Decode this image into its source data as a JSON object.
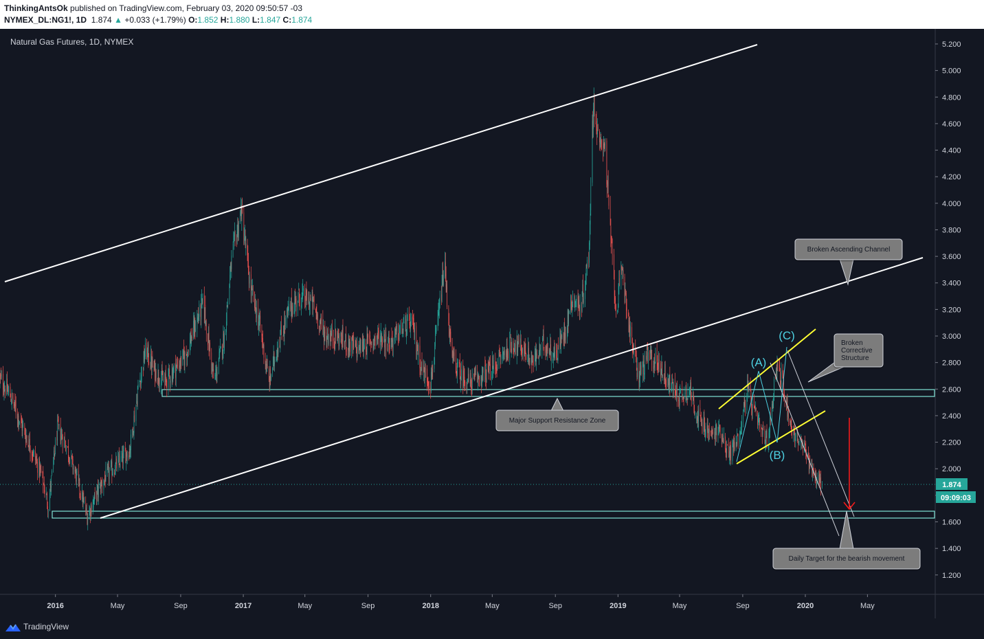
{
  "header": {
    "author": "ThinkingAntsOk",
    "published_text": "published on TradingView.com, February 03, 2020 09:50:57 -03",
    "symbol": "NYMEX_DL:NG1!, 1D",
    "last": "1.874",
    "change": "+0.033 (+1.79%)",
    "open_label": "O:",
    "open": "1.852",
    "high_label": "H:",
    "high": "1.880",
    "low_label": "L:",
    "low": "1.847",
    "close_label": "C:",
    "close": "1.874"
  },
  "chart": {
    "title": "Natural Gas Futures, 1D, NYMEX",
    "price_tag": "1.874",
    "countdown": "09:09:03"
  },
  "annotations": {
    "broken_channel": "Broken Ascending Channel",
    "broken_structure": [
      "Broken",
      "Corrective",
      "Structure"
    ],
    "support_zone": "Major Support Resistance Zone",
    "daily_target": "Daily Target for the bearish movement",
    "wave_a": "(A)",
    "wave_b": "(B)",
    "wave_c": "(C)"
  },
  "footer": {
    "brand": "TradingView"
  },
  "colors": {
    "background": "#131722",
    "up": "#26a69a",
    "down": "#ef5350",
    "channel": "#ffffff",
    "zone": "#7fe3d6",
    "wave_line": "#ffff33",
    "wave_label": "#4dd0e1",
    "target_arrow": "#ff0000"
  },
  "chart_data": {
    "type": "candlestick",
    "title": "Natural Gas Futures, 1D, NYMEX",
    "ylim": [
      1.1,
      5.3
    ],
    "y_ticks": [
      "1.200",
      "1.400",
      "1.600",
      "1.800",
      "2.000",
      "2.200",
      "2.400",
      "2.600",
      "2.800",
      "3.000",
      "3.200",
      "3.400",
      "3.600",
      "3.800",
      "4.000",
      "4.200",
      "4.400",
      "4.600",
      "4.800",
      "5.000",
      "5.200"
    ],
    "x_ticks": [
      "2016",
      "May",
      "Sep",
      "2017",
      "May",
      "Sep",
      "2018",
      "May",
      "Sep",
      "2019",
      "May",
      "Sep",
      "2020",
      "May"
    ],
    "x_tick_dates": [
      "2016-01-01",
      "2016-05-01",
      "2016-09-01",
      "2017-01-01",
      "2017-05-01",
      "2017-09-01",
      "2018-01-01",
      "2018-05-01",
      "2018-09-01",
      "2019-01-01",
      "2019-05-01",
      "2019-09-01",
      "2020-01-01",
      "2020-05-01"
    ],
    "x_range": [
      "2015-09-15",
      "2020-09-10"
    ],
    "price_path": [
      [
        "2015-09-15",
        2.68
      ],
      [
        "2015-10-05",
        2.55
      ],
      [
        "2015-10-25",
        2.35
      ],
      [
        "2015-11-15",
        2.15
      ],
      [
        "2015-12-05",
        1.95
      ],
      [
        "2015-12-18",
        1.72
      ],
      [
        "2016-01-05",
        2.3
      ],
      [
        "2016-01-20",
        2.2
      ],
      [
        "2016-02-10",
        1.95
      ],
      [
        "2016-03-03",
        1.64
      ],
      [
        "2016-03-20",
        1.8
      ],
      [
        "2016-04-10",
        1.95
      ],
      [
        "2016-05-05",
        2.05
      ],
      [
        "2016-05-25",
        2.15
      ],
      [
        "2016-06-10",
        2.6
      ],
      [
        "2016-06-25",
        2.9
      ],
      [
        "2016-07-10",
        2.75
      ],
      [
        "2016-08-01",
        2.65
      ],
      [
        "2016-08-20",
        2.75
      ],
      [
        "2016-09-10",
        2.85
      ],
      [
        "2016-10-01",
        3.1
      ],
      [
        "2016-10-15",
        3.25
      ],
      [
        "2016-11-05",
        2.65
      ],
      [
        "2016-11-25",
        3.0
      ],
      [
        "2016-12-10",
        3.6
      ],
      [
        "2016-12-28",
        3.95
      ],
      [
        "2017-01-15",
        3.35
      ],
      [
        "2017-02-01",
        3.1
      ],
      [
        "2017-02-20",
        2.65
      ],
      [
        "2017-03-10",
        2.95
      ],
      [
        "2017-04-01",
        3.2
      ],
      [
        "2017-04-20",
        3.3
      ],
      [
        "2017-05-15",
        3.25
      ],
      [
        "2017-06-10",
        3.0
      ],
      [
        "2017-07-01",
        3.0
      ],
      [
        "2017-07-20",
        2.95
      ],
      [
        "2017-08-10",
        2.9
      ],
      [
        "2017-09-01",
        2.95
      ],
      [
        "2017-09-25",
        3.0
      ],
      [
        "2017-10-15",
        2.95
      ],
      [
        "2017-11-05",
        3.05
      ],
      [
        "2017-11-25",
        3.1
      ],
      [
        "2017-12-15",
        2.75
      ],
      [
        "2018-01-01",
        2.65
      ],
      [
        "2018-01-15",
        3.1
      ],
      [
        "2018-01-28",
        3.55
      ],
      [
        "2018-02-10",
        2.85
      ],
      [
        "2018-03-01",
        2.7
      ],
      [
        "2018-03-20",
        2.65
      ],
      [
        "2018-04-10",
        2.7
      ],
      [
        "2018-05-01",
        2.75
      ],
      [
        "2018-05-20",
        2.85
      ],
      [
        "2018-06-10",
        2.95
      ],
      [
        "2018-07-01",
        2.9
      ],
      [
        "2018-07-20",
        2.8
      ],
      [
        "2018-08-10",
        2.95
      ],
      [
        "2018-09-01",
        2.85
      ],
      [
        "2018-09-20",
        3.05
      ],
      [
        "2018-10-05",
        3.3
      ],
      [
        "2018-10-20",
        3.2
      ],
      [
        "2018-11-05",
        3.6
      ],
      [
        "2018-11-14",
        4.8
      ],
      [
        "2018-11-25",
        4.4
      ],
      [
        "2018-12-05",
        4.5
      ],
      [
        "2018-12-15",
        3.9
      ],
      [
        "2018-12-28",
        3.2
      ],
      [
        "2019-01-10",
        3.5
      ],
      [
        "2019-01-25",
        3.0
      ],
      [
        "2019-02-10",
        2.7
      ],
      [
        "2019-03-01",
        2.85
      ],
      [
        "2019-03-20",
        2.8
      ],
      [
        "2019-04-10",
        2.65
      ],
      [
        "2019-05-01",
        2.55
      ],
      [
        "2019-05-20",
        2.6
      ],
      [
        "2019-06-10",
        2.35
      ],
      [
        "2019-07-01",
        2.25
      ],
      [
        "2019-07-20",
        2.3
      ],
      [
        "2019-08-05",
        2.1
      ],
      [
        "2019-08-25",
        2.25
      ],
      [
        "2019-09-10",
        2.6
      ],
      [
        "2019-09-25",
        2.4
      ],
      [
        "2019-10-10",
        2.25
      ],
      [
        "2019-10-20",
        2.2
      ],
      [
        "2019-11-06",
        2.8
      ],
      [
        "2019-11-20",
        2.6
      ],
      [
        "2019-12-05",
        2.3
      ],
      [
        "2019-12-20",
        2.2
      ],
      [
        "2020-01-05",
        2.1
      ],
      [
        "2020-01-20",
        1.95
      ],
      [
        "2020-02-03",
        1.874
      ]
    ],
    "last_price": 1.874
  }
}
